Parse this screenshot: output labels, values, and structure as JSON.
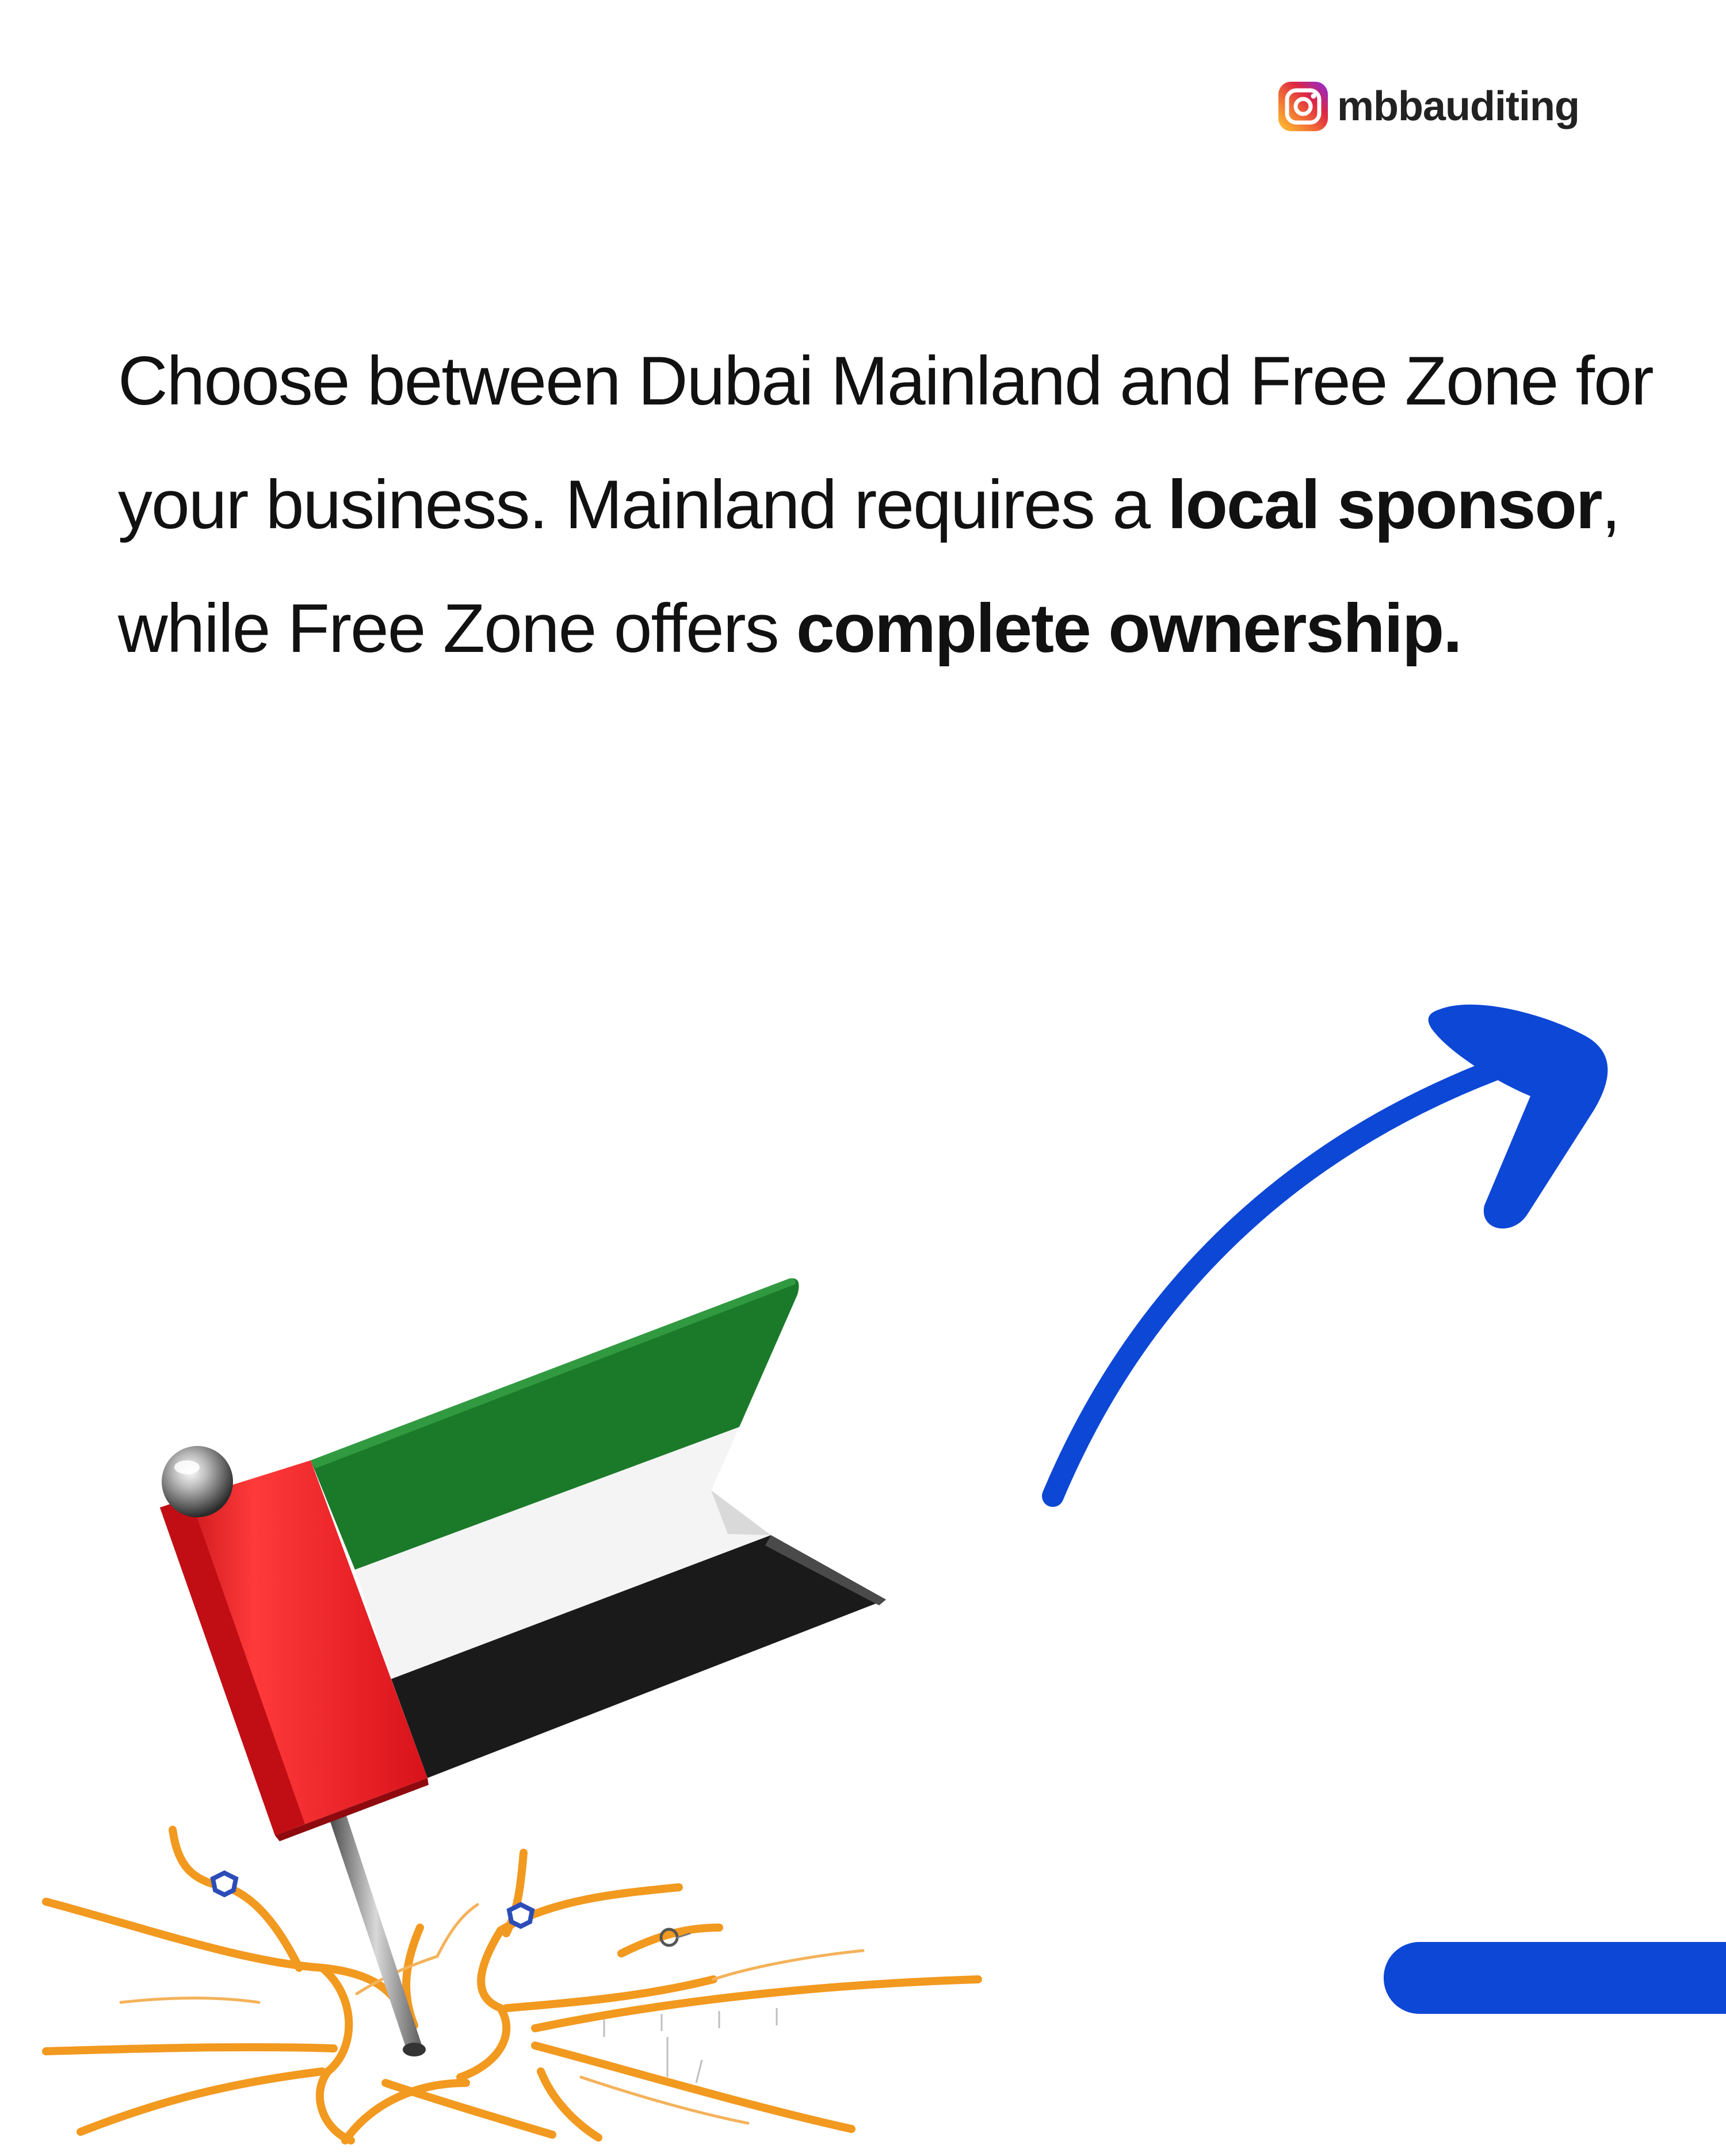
{
  "brand": {
    "icon": "instagram-icon",
    "handle": "mbbauditing"
  },
  "message": {
    "part1": "Choose between Dubai Mainland and Free Zone for your business. Mainland requires a ",
    "bold1": "local sponsor",
    "part2": ", while Free Zone offers ",
    "bold2": "complete ownership."
  },
  "illustration": {
    "flag_icon": "uae-flag-pin-icon",
    "map_icon": "road-map-icon",
    "arrow_icon": "curved-arrow-icon",
    "colors": {
      "flag_red": "#e8141b",
      "flag_green": "#1b7a2a",
      "flag_white": "#f4f4f4",
      "flag_black": "#1a1a1a",
      "road_orange": "#f2991f",
      "arrow_blue": "#0d47d6"
    }
  }
}
